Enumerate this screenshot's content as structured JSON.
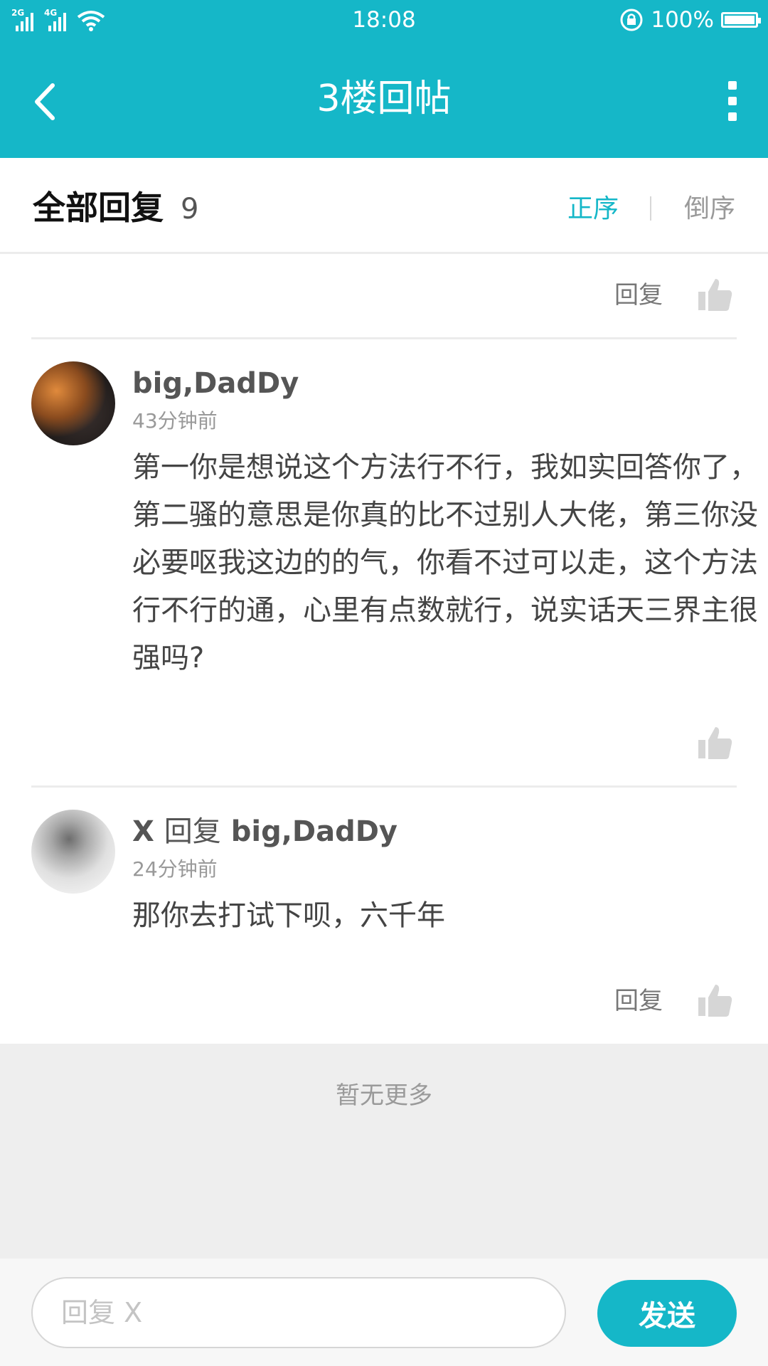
{
  "status_bar": {
    "network1": "2G",
    "network2": "4G",
    "time": "18:08",
    "battery": "100%"
  },
  "nav": {
    "title": "3楼回帖",
    "back_icon": "back-arrow-icon",
    "more_icon": "more-vertical-icon"
  },
  "section": {
    "title": "全部回复",
    "count": "9",
    "sort_asc": "正序",
    "sort_desc": "倒序"
  },
  "top_item": {
    "reply_label": "回复"
  },
  "replies": [
    {
      "username": "big,DadDy",
      "time": "43分钟前",
      "content": "第一你是想说这个方法行不行，我如实回答你了，第二骚的意思是你真的比不过别人大佬，第三你没必要呕我这边的的气，你看不过可以走，这个方法行不行的通，心里有点数就行，说实话天三界主很强吗?"
    },
    {
      "username": "X",
      "reply_word": "回复",
      "reply_target": "big,DadDy",
      "time": "24分钟前",
      "content": "那你去打试下呗，六千年",
      "reply_label": "回复"
    }
  ],
  "footer": {
    "no_more": "暂无更多"
  },
  "bottom": {
    "input_placeholder": "回复 X",
    "input_value": "",
    "send_label": "发送"
  },
  "colors": {
    "accent": "#15b7c8",
    "background_footer": "#eeeeee"
  }
}
